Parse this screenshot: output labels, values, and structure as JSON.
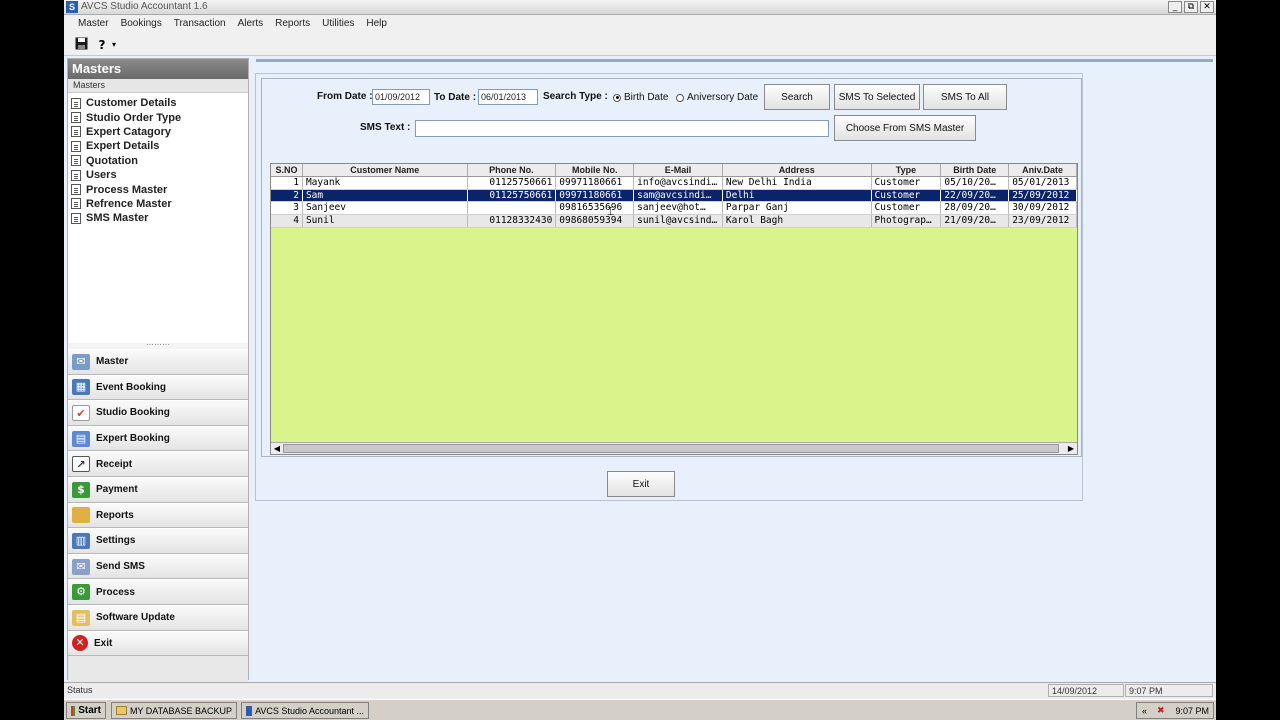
{
  "window": {
    "title": "AVCS Studio Accountant 1.6",
    "min": "_",
    "restore": "⧉",
    "close": "✕"
  },
  "menu": [
    "Master",
    "Bookings",
    "Transaction",
    "Alerts",
    "Reports",
    "Utilities",
    "Help"
  ],
  "toolbar": {
    "save_icon": "floppy-disk-icon",
    "help_label": "?"
  },
  "masters": {
    "header": "Masters",
    "subheader": "Masters",
    "items": [
      "Customer Details",
      "Studio Order Type",
      "Expert Catagory",
      "Expert Details",
      "Quotation",
      "Users",
      "Process Master",
      "Refrence Master",
      "SMS Master"
    ]
  },
  "nav": [
    {
      "label": "Master",
      "icon": "master-icon",
      "color": "#7a9cc8"
    },
    {
      "label": "Event Booking",
      "icon": "calendar-icon",
      "color": "#4a78b8"
    },
    {
      "label": "Studio Booking",
      "icon": "checklist-icon",
      "color": "#c84848"
    },
    {
      "label": "Expert Booking",
      "icon": "expert-icon",
      "color": "#5a8ad0"
    },
    {
      "label": "Receipt",
      "icon": "receipt-icon",
      "color": "#444444"
    },
    {
      "label": "Payment",
      "icon": "payment-icon",
      "color": "#3a9a3a"
    },
    {
      "label": "Reports",
      "icon": "folder-icon",
      "color": "#e0b040"
    },
    {
      "label": "Settings",
      "icon": "settings-icon",
      "color": "#4a78b8"
    },
    {
      "label": "Send SMS",
      "icon": "sms-icon",
      "color": "#8aa0c8"
    },
    {
      "label": "Process",
      "icon": "process-icon",
      "color": "#3a9a3a"
    },
    {
      "label": "Software Update",
      "icon": "update-icon",
      "color": "#e0c060"
    },
    {
      "label": "Exit",
      "icon": "exit-icon",
      "color": "#d02020"
    }
  ],
  "form": {
    "from_label": "From Date :",
    "from_value": "01/09/2012",
    "to_label": "To Date :",
    "to_value": "06/01/2013",
    "search_type_label": "Search Type :",
    "radio_birth": "Birth Date",
    "radio_anniv": "Aniversory Date",
    "search_btn": "Search",
    "sms_selected_btn": "SMS To Selected",
    "sms_all_btn": "SMS To All",
    "sms_text_label": "SMS Text :",
    "sms_text_value": "",
    "choose_btn": "Choose From SMS Master",
    "exit_btn": "Exit"
  },
  "grid": {
    "columns": [
      "S.NO",
      "Customer Name",
      "Phone No.",
      "Mobile No.",
      "E-Mail",
      "Address",
      "Type",
      "Birth Date",
      "Aniv.Date"
    ],
    "rows": [
      [
        "1",
        "Mayank",
        "01125750661",
        "09971180661",
        "info@avcsindi…",
        "New Delhi India",
        "Customer",
        "05/10/20…",
        "05/01/2013"
      ],
      [
        "2",
        "Sam",
        "01125750661",
        "09971180661",
        "sam@avcsindi…",
        "Delhi",
        "Customer",
        "22/09/20…",
        "25/09/2012"
      ],
      [
        "3",
        "Sanjeev",
        "",
        "09816535696",
        "sanjeev@hot…",
        "Parpar Ganj",
        "Customer",
        "28/09/20…",
        "30/09/2012"
      ],
      [
        "4",
        "Sunil",
        "01128332430",
        "09868059394",
        "sunil@avcsind…",
        "Karol Bagh",
        "Photograp…",
        "21/09/20…",
        "23/09/2012"
      ]
    ],
    "selected_row": 2,
    "bg_color": "#d9f48a"
  },
  "status": {
    "label": "Status",
    "date": "14/09/2012",
    "time": "9:07 PM"
  },
  "taskbar": {
    "start": "Start",
    "items": [
      "MY DATABASE BACKUP",
      "AVCS Studio Accountant ..."
    ],
    "clock": "9:07 PM",
    "tray_arrows": "«"
  }
}
